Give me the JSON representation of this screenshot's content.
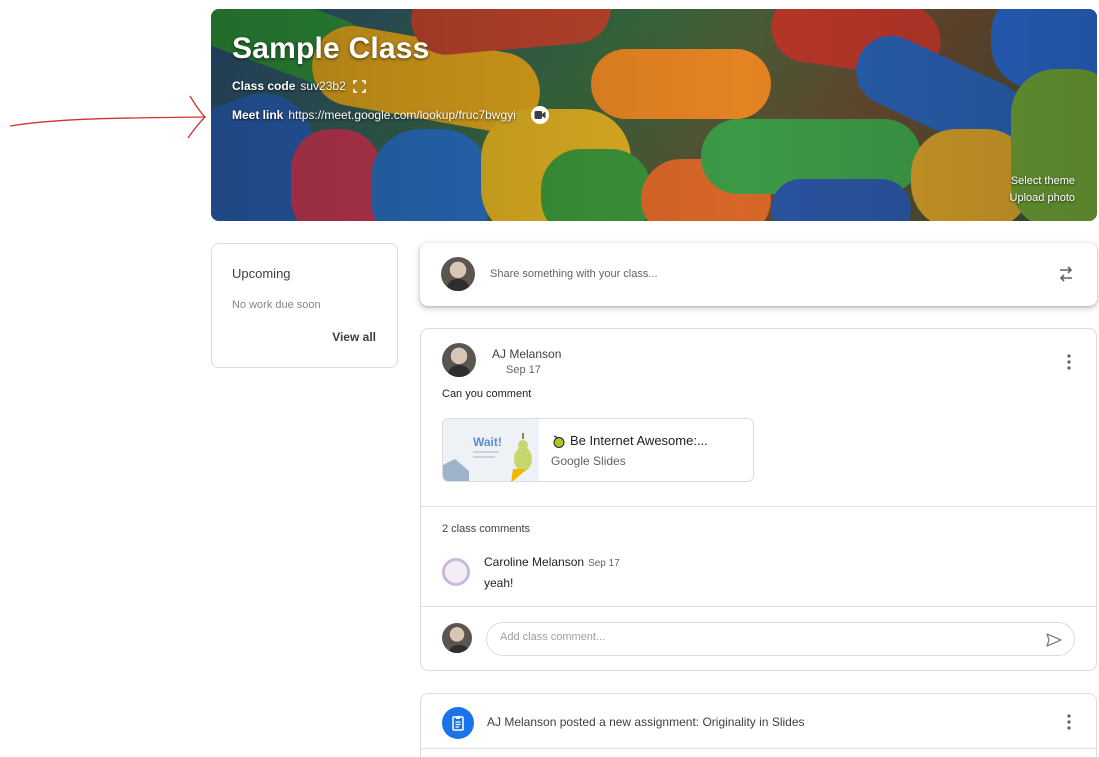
{
  "banner": {
    "title": "Sample Class",
    "class_code_label": "Class code",
    "class_code": "suv23b2",
    "meet_label": "Meet link",
    "meet_url": "https://meet.google.com/lookup/fruc7bwgyi",
    "select_theme": "Select theme",
    "upload_photo": "Upload photo"
  },
  "upcoming": {
    "title": "Upcoming",
    "empty_text": "No work due soon",
    "view_all": "View all"
  },
  "share": {
    "placeholder": "Share something with your class..."
  },
  "post": {
    "author": "AJ Melanson",
    "date": "Sep 17",
    "text": "Can you comment",
    "attachment": {
      "title": "Be Internet Awesome:...",
      "type": "Google Slides",
      "thumb_text": "Wait!"
    },
    "comments_count": "2 class comments",
    "comment": {
      "author": "Caroline Melanson",
      "date": "Sep 17",
      "text": "yeah!"
    },
    "comment_placeholder": "Add class comment..."
  },
  "assignment": {
    "text": "AJ Melanson posted a new assignment: Originality in Slides"
  },
  "colors": {
    "annotation": "#d0342c",
    "accent_blue": "#1a73e8",
    "border": "#dadce0"
  }
}
